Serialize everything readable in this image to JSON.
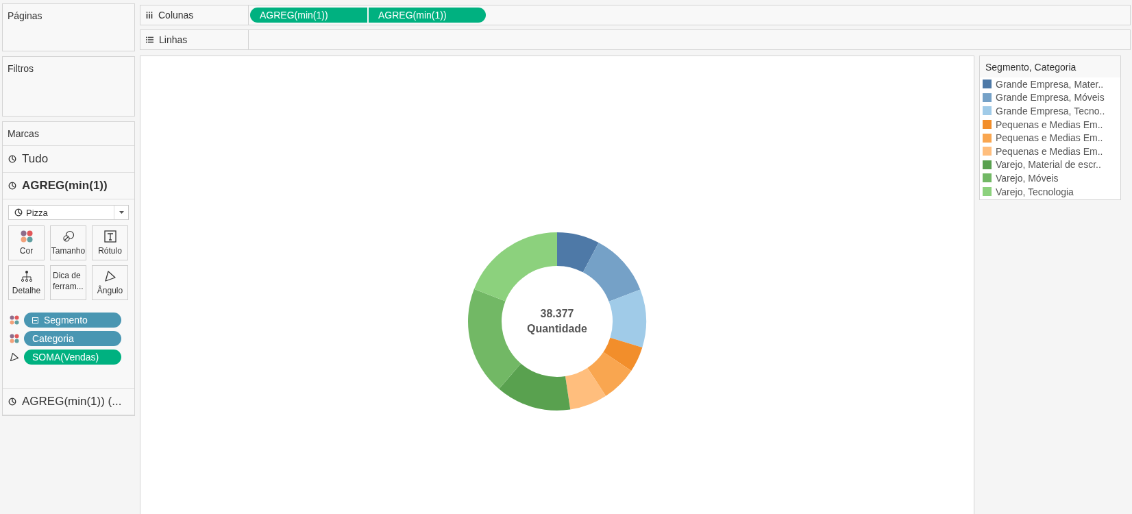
{
  "pages": {
    "title": "Páginas"
  },
  "columns_shelf": {
    "label": "Colunas",
    "pills": [
      "AGREG(min(1))",
      "AGREG(min(1))"
    ]
  },
  "rows_shelf": {
    "label": "Linhas"
  },
  "filters": {
    "title": "Filtros"
  },
  "marks": {
    "title": "Marcas",
    "layers": [
      {
        "label": "Tudo",
        "expanded": false
      },
      {
        "label": "AGREG(min(1))",
        "expanded": true,
        "mark_type": "Pizza",
        "buttons": [
          {
            "kind": "color",
            "label": "Cor"
          },
          {
            "kind": "size",
            "label": "Tamanho"
          },
          {
            "kind": "label",
            "label": "Rótulo"
          },
          {
            "kind": "detail",
            "label": "Detalhe"
          },
          {
            "kind": "tooltip",
            "label": "Dica de ferram..."
          },
          {
            "kind": "angle",
            "label": "Ângulo"
          }
        ],
        "fields": [
          {
            "kind": "color",
            "color": "#4996b2",
            "hierarchy": true,
            "label": "Segmento"
          },
          {
            "kind": "color",
            "color": "#4996b2",
            "hierarchy": false,
            "label": "Categoria"
          },
          {
            "kind": "angle",
            "color": "#00b180",
            "hierarchy": false,
            "label": "SOMA(Vendas)"
          }
        ]
      },
      {
        "label": "AGREG(min(1)) (...",
        "expanded": false
      }
    ]
  },
  "chart": {
    "value": "38.377",
    "caption": "Quantidade"
  },
  "legend": {
    "title": "Segmento, Categoria",
    "items": [
      {
        "label": "Grande Empresa, Mater..",
        "color": "#4e79a7"
      },
      {
        "label": "Grande Empresa, Móveis",
        "color": "#75a1c7"
      },
      {
        "label": "Grande Empresa, Tecno..",
        "color": "#a0cbe8"
      },
      {
        "label": "Pequenas e Medias Em..",
        "color": "#f28e2b"
      },
      {
        "label": "Pequenas e Medias Em..",
        "color": "#f9a650"
      },
      {
        "label": "Pequenas e Medias Em..",
        "color": "#ffbe7d"
      },
      {
        "label": "Varejo, Material de escr..",
        "color": "#59a14f"
      },
      {
        "label": "Varejo, Móveis",
        "color": "#72b865"
      },
      {
        "label": "Varejo, Tecnologia",
        "color": "#8cd17d"
      }
    ]
  }
}
